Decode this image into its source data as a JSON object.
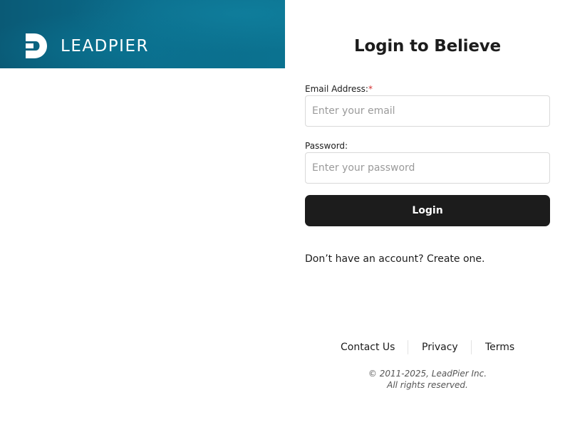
{
  "brand": {
    "name": "LEADPIER",
    "logo_icon": "leadpier-logo-icon",
    "banner_color": "#0b6d8c"
  },
  "login": {
    "title": "Login to Believe",
    "email": {
      "label": "Email Address:",
      "required_marker": "*",
      "value": "",
      "placeholder": "Enter your email"
    },
    "password": {
      "label": "Password:",
      "value": "",
      "placeholder": "Enter your password"
    },
    "submit_label": "Login",
    "signup": {
      "prompt": "Don’t have an account?",
      "link_label": "Create one."
    }
  },
  "footer": {
    "links": [
      "Contact Us",
      "Privacy",
      "Terms"
    ],
    "copyright": "© 2011-2025, LeadPier Inc.",
    "rights": "All rights reserved."
  },
  "colors": {
    "button": "#1c1c1c",
    "required": "#d32f2f",
    "input_border": "#d9d9d9"
  }
}
